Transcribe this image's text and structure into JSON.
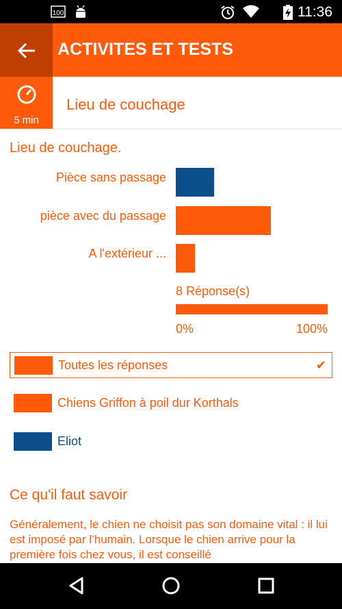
{
  "status_bar": {
    "time": "11:36",
    "notification_badge": "100",
    "icons": [
      "notification-100-icon",
      "android-icon",
      "alarm-icon",
      "wifi-icon",
      "battery-charging-icon"
    ]
  },
  "app_bar": {
    "title": "ACTIVITES ET TESTS",
    "back_icon": "arrow-left-icon"
  },
  "timer": {
    "label": "5 min",
    "icon": "timer-icon"
  },
  "subheader": {
    "title": "Lieu de couchage"
  },
  "question": {
    "title": "Lieu de couchage."
  },
  "colors": {
    "accent": "#ff5a0a",
    "accent_dark": "#bf3e00",
    "series_eliot": "#0b4e8c"
  },
  "chart_data": {
    "type": "bar",
    "orientation": "horizontal",
    "categories": [
      "Pièce sans passage",
      "pièce avec du passage",
      "A l'extérieur ..."
    ],
    "series": [
      {
        "name": "Eliot",
        "values": [
          25,
          0,
          0
        ],
        "color": "#0b4e8c"
      },
      {
        "name": "Chiens Griffon à poil dur Korthals",
        "values": [
          0,
          62.5,
          12.5
        ],
        "color": "#ff5a0a"
      }
    ],
    "responses_label": "8 Réponse(s)",
    "xlim": [
      0,
      100
    ],
    "tick_labels": [
      "0%",
      "100%"
    ]
  },
  "legend": {
    "items": [
      {
        "label": "Toutes les réponses",
        "color": "#ff5a0a",
        "selected": true
      },
      {
        "label": "Chiens Griffon à poil dur Korthals",
        "color": "#ff5a0a",
        "selected": false
      },
      {
        "label": "Eliot",
        "color": "#0b4e8c",
        "selected": false
      }
    ],
    "check": "✔"
  },
  "info": {
    "heading": "Ce qu'il faut savoir",
    "text": "Généralement, le chien ne choisit pas son domaine vital : il lui est imposé par l’humain. Lorsque le chien arrive pour la première fois chez vous, il est conseillé"
  },
  "nav": {
    "icons": [
      "back-triangle-icon",
      "home-circle-icon",
      "recents-square-icon"
    ]
  }
}
